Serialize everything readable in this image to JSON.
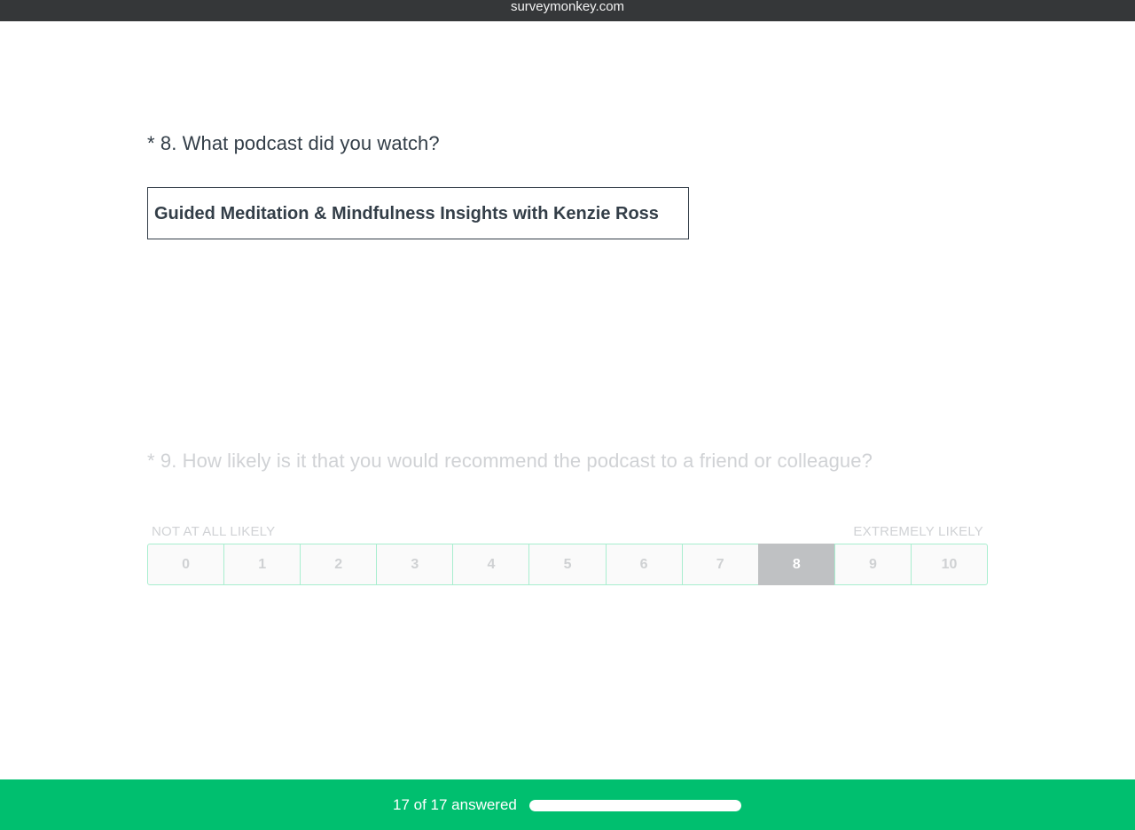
{
  "browser": {
    "domain": "surveymonkey.com"
  },
  "question8": {
    "title": "* 8. What podcast did you watch?",
    "answer_value": "Guided Meditation & Mindfulness Insights with Kenzie Ross"
  },
  "question9": {
    "title": "* 9. How likely is it that you would recommend the podcast to a friend or colleague?",
    "label_low": "NOT AT ALL LIKELY",
    "label_high": "EXTREMELY LIKELY",
    "options": [
      "0",
      "1",
      "2",
      "3",
      "4",
      "5",
      "6",
      "7",
      "8",
      "9",
      "10"
    ],
    "selected": "8"
  },
  "footer": {
    "progress_text": "17 of 17 answered",
    "progress_fraction": 1.0
  },
  "colors": {
    "accent": "#00bf6f",
    "topbar": "#353739",
    "selected_option": "#bfc1c3"
  }
}
